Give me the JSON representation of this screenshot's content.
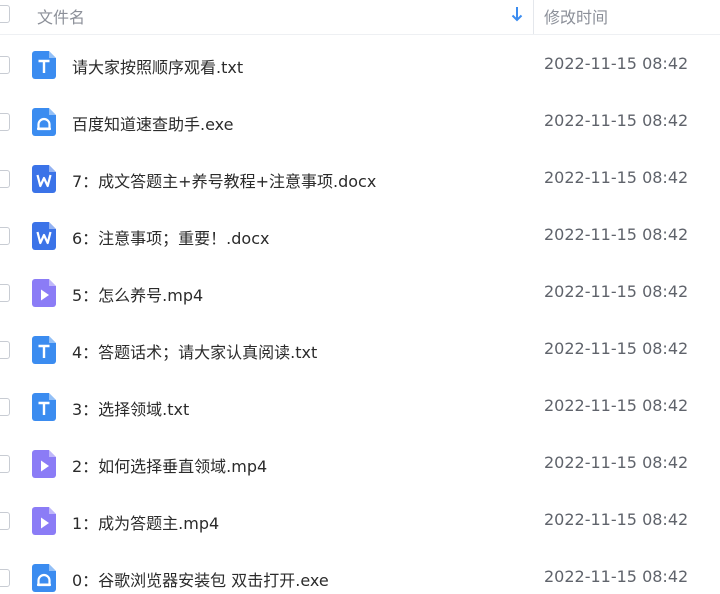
{
  "header": {
    "name_label": "文件名",
    "time_label": "修改时间",
    "sort_icon": "arrow-down-icon"
  },
  "colors": {
    "txt": "#3b8cf0",
    "exe": "#3b8cf0",
    "docx": "#3b73e8",
    "mp4": "#8b7cf6"
  },
  "files": [
    {
      "name": "请大家按照顺序观看.txt",
      "time": "2022-11-15 08:42",
      "type": "txt"
    },
    {
      "name": "百度知道速查助手.exe",
      "time": "2022-11-15 08:42",
      "type": "exe"
    },
    {
      "name": "7：成文答题主+养号教程+注意事项.docx",
      "time": "2022-11-15 08:42",
      "type": "docx"
    },
    {
      "name": "6：注意事项；重要！.docx",
      "time": "2022-11-15 08:42",
      "type": "docx"
    },
    {
      "name": "5：怎么养号.mp4",
      "time": "2022-11-15 08:42",
      "type": "mp4"
    },
    {
      "name": "4：答题话术；请大家认真阅读.txt",
      "time": "2022-11-15 08:42",
      "type": "txt"
    },
    {
      "name": "3：选择领域.txt",
      "time": "2022-11-15 08:42",
      "type": "txt"
    },
    {
      "name": "2：如何选择垂直领域.mp4",
      "time": "2022-11-15 08:42",
      "type": "mp4"
    },
    {
      "name": "1：成为答题主.mp4",
      "time": "2022-11-15 08:42",
      "type": "mp4"
    },
    {
      "name": "0：谷歌浏览器安装包 双击打开.exe",
      "time": "2022-11-15 08:42",
      "type": "exe"
    }
  ]
}
